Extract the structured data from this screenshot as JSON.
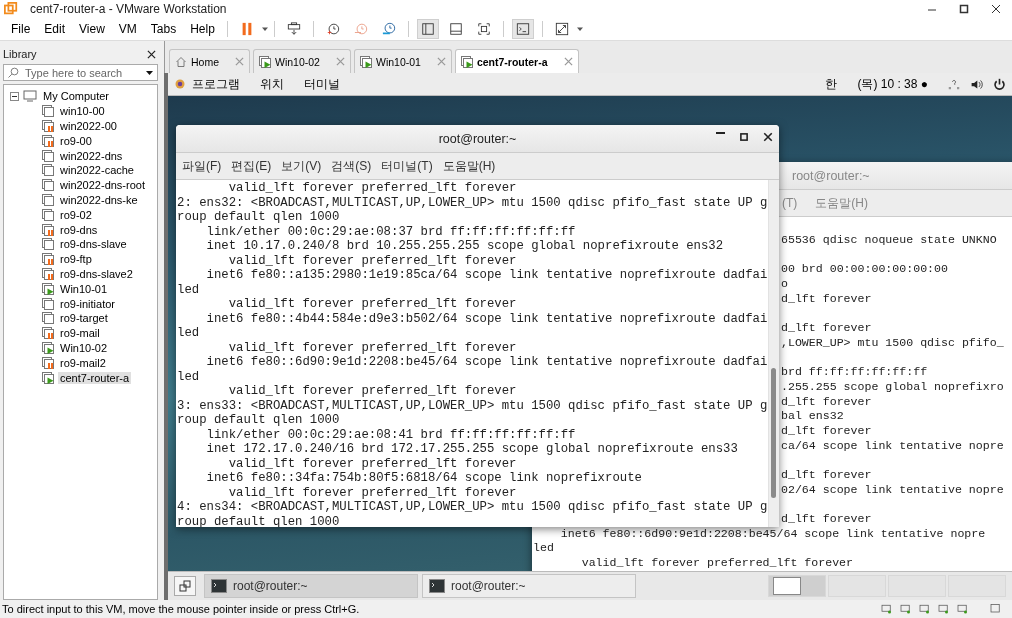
{
  "window": {
    "title": "cent7-router-a - VMware Workstation"
  },
  "menus": [
    "File",
    "Edit",
    "View",
    "VM",
    "Tabs",
    "Help"
  ],
  "toolbar_groups": [
    [
      {
        "kind": "pause",
        "pressed": false
      }
    ],
    [
      {
        "kind": "send-keys",
        "pressed": false
      }
    ],
    [
      {
        "kind": "snapshot",
        "pressed": false
      },
      {
        "kind": "revert",
        "pressed": false
      },
      {
        "kind": "snapshot-manager",
        "pressed": false
      }
    ],
    [
      {
        "kind": "library-view",
        "pressed": true
      },
      {
        "kind": "thumbnail-bar",
        "pressed": false
      },
      {
        "kind": "fit-guest",
        "pressed": false
      }
    ],
    [
      {
        "kind": "console",
        "pressed": true
      }
    ],
    [
      {
        "kind": "fullscreen",
        "pressed": false
      }
    ]
  ],
  "library": {
    "title": "Library",
    "search": {
      "placeholder": "Type here to search"
    },
    "tree": [
      {
        "label": "My Computer",
        "expanded": true,
        "children": [
          {
            "label": "win10-00",
            "kind": "off",
            "selected": false
          },
          {
            "label": "win2022-00",
            "kind": "suspended",
            "selected": false
          },
          {
            "label": "ro9-00",
            "kind": "suspended",
            "selected": false
          },
          {
            "label": "win2022-dns",
            "kind": "off",
            "selected": false
          },
          {
            "label": "win2022-cache",
            "kind": "off",
            "selected": false
          },
          {
            "label": "win2022-dns-root",
            "kind": "off",
            "selected": false
          },
          {
            "label": "win2022-dns-ke",
            "kind": "off",
            "selected": false
          },
          {
            "label": "ro9-02",
            "kind": "off",
            "selected": false
          },
          {
            "label": "ro9-dns",
            "kind": "suspended",
            "selected": false
          },
          {
            "label": "ro9-dns-slave",
            "kind": "off",
            "selected": false
          },
          {
            "label": "ro9-ftp",
            "kind": "suspended",
            "selected": false
          },
          {
            "label": "ro9-dns-slave2",
            "kind": "suspended",
            "selected": false
          },
          {
            "label": "Win10-01",
            "kind": "running",
            "selected": false
          },
          {
            "label": "ro9-initiator",
            "kind": "off",
            "selected": false
          },
          {
            "label": "ro9-target",
            "kind": "off",
            "selected": false
          },
          {
            "label": "ro9-mail",
            "kind": "suspended",
            "selected": false
          },
          {
            "label": "Win10-02",
            "kind": "running",
            "selected": false
          },
          {
            "label": "ro9-mail2",
            "kind": "suspended",
            "selected": false
          },
          {
            "label": "cent7-router-a",
            "kind": "running",
            "selected": true
          }
        ]
      }
    ]
  },
  "tabs": [
    {
      "label": "Home",
      "kind": "home",
      "selected": false
    },
    {
      "label": "Win10-02",
      "kind": "vm",
      "selected": false
    },
    {
      "label": "Win10-01",
      "kind": "vm",
      "selected": false
    },
    {
      "label": "cent7-router-a",
      "kind": "vm",
      "selected": true
    }
  ],
  "guest_top_bar": {
    "menus": [
      "프로그램",
      "위치",
      "터미널"
    ],
    "input_method": "한",
    "clock": "(목) 10 : 38 ●"
  },
  "front_terminal": {
    "title": "root@router:~",
    "menus": [
      "파일(F)",
      "편집(E)",
      "보기(V)",
      "검색(S)",
      "터미널(T)",
      "도움말(H)"
    ],
    "lines": [
      "       valid_lft forever preferred_lft forever",
      "2: ens32: <BROADCAST,MULTICAST,UP,LOWER_UP> mtu 1500 qdisc pfifo_fast state UP g",
      "roup default qlen 1000",
      "    link/ether 00:0c:29:ae:08:37 brd ff:ff:ff:ff:ff:ff",
      "    inet 10.17.0.240/8 brd 10.255.255.255 scope global noprefixroute ens32",
      "       valid_lft forever preferred_lft forever",
      "    inet6 fe80::a135:2980:1e19:85ca/64 scope link tentative noprefixroute dadfai",
      "led",
      "       valid_lft forever preferred_lft forever",
      "    inet6 fe80::4b44:584e:d9e3:b502/64 scope link tentative noprefixroute dadfai",
      "led",
      "       valid_lft forever preferred_lft forever",
      "    inet6 fe80::6d90:9e1d:2208:be45/64 scope link tentative noprefixroute dadfai",
      "led",
      "       valid_lft forever preferred_lft forever",
      "3: ens33: <BROADCAST,MULTICAST,UP,LOWER_UP> mtu 1500 qdisc pfifo_fast state UP g",
      "roup default qlen 1000",
      "    link/ether 00:0c:29:ae:08:41 brd ff:ff:ff:ff:ff:ff",
      "    inet 172.17.0.240/16 brd 172.17.255.255 scope global noprefixroute ens33",
      "       valid_lft forever preferred_lft forever",
      "    inet6 fe80::34fa:754b:80f5:6818/64 scope link noprefixroute",
      "       valid_lft forever preferred_lft forever",
      "4: ens34: <BROADCAST,MULTICAST,UP,LOWER_UP> mtu 1500 qdisc pfifo_fast state UP g",
      "roup default qlen 1000"
    ]
  },
  "back_terminal": {
    "title": "root@router:~",
    "menus": [
      "(T)",
      "도움말(H)"
    ],
    "right_blocks": [
      [
        "65536 qdisc noqueue state UNKNO"
      ],
      [
        "00 brd 00:00:00:00:00:00",
        "o",
        "d_lft forever"
      ],
      [
        "d_lft forever",
        ",LOWER_UP> mtu 1500 qdisc pfifo_"
      ],
      [
        "brd ff:ff:ff:ff:ff:ff",
        ".255.255 scope global noprefixro",
        "d_lft forever",
        "bal ens32",
        "d_lft forever",
        "ca/64 scope link tentative nopre"
      ],
      [
        "d_lft forever",
        "02/64 scope link tentative nopre"
      ],
      [
        "d_lft forever"
      ]
    ],
    "bottom_lines": [
      "    inet6 fe80::6d90:9e1d:2208:be45/64 scope link tentative nopre",
      "led",
      "       valid_lft forever preferred_lft forever"
    ]
  },
  "taskbar": {
    "tasks": [
      {
        "label": "root@router:~",
        "selected": true
      },
      {
        "label": "root@router:~",
        "selected": false
      }
    ],
    "workspaces": [
      {
        "selected": true
      },
      {
        "selected": false
      },
      {
        "selected": false
      },
      {
        "selected": false
      }
    ]
  },
  "status_bar": {
    "text": "To direct input to this VM, move the mouse pointer inside or press Ctrl+G."
  }
}
